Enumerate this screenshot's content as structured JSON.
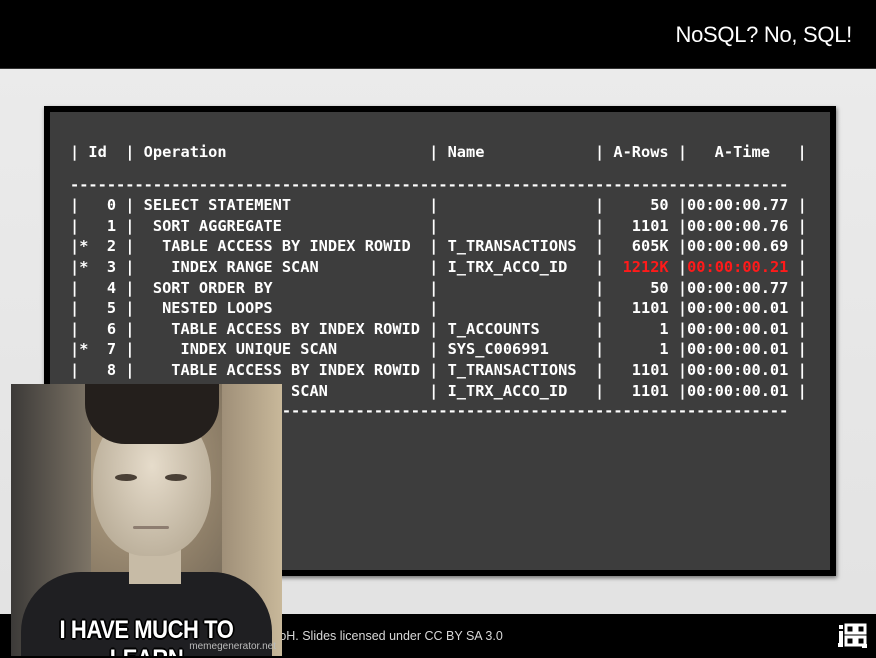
{
  "slide": {
    "title": "NoSQL? No, SQL!"
  },
  "plan": {
    "header": "| Id  | Operation                      | Name            | A-Rows |   A-Time   |",
    "separator": "------------------------------------------------------------------------------",
    "rows": [
      {
        "pre": "|   0 | SELECT STATEMENT               |                 |     50 |",
        "time": "00:00:00.77",
        "post": " |"
      },
      {
        "pre": "|   1 |  SORT AGGREGATE                |                 |   1101 |",
        "time": "00:00:00.76",
        "post": " |"
      },
      {
        "pre": "|*  2 |   TABLE ACCESS BY INDEX ROWID  | T_TRANSACTIONS  |   605K |",
        "time": "00:00:00.69",
        "post": " |"
      },
      {
        "pre": "|*  3 |    INDEX RANGE SCAN            | I_TRX_ACCO_ID   |  ",
        "rows_hl": "1212K",
        "sep": " |",
        "time_hl": "00:00:00.21",
        "post": " |"
      },
      {
        "pre": "|   4 |  SORT ORDER BY                 |                 |     50 |",
        "time": "00:00:00.77",
        "post": " |"
      },
      {
        "pre": "|   5 |   NESTED LOOPS                 |                 |   1101 |",
        "time": "00:00:00.01",
        "post": " |"
      },
      {
        "pre": "|   6 |    TABLE ACCESS BY INDEX ROWID | T_ACCOUNTS      |      1 |",
        "time": "00:00:00.01",
        "post": " |"
      },
      {
        "pre": "|*  7 |     INDEX UNIQUE SCAN          | SYS_C006991     |      1 |",
        "time": "00:00:00.01",
        "post": " |"
      },
      {
        "pre": "|   8 |    TABLE ACCESS BY INDEX ROWID | T_TRANSACTIONS  |   1101 |",
        "time": "00:00:00.01",
        "post": " |"
      },
      {
        "pre": "|*  9 |     INDEX RANGE SCAN           | I_TRX_ACCO_ID   |   1101 |",
        "time": "00:00:00.01",
        "post": " |"
      }
    ],
    "highlight_color": "#ff1a1a"
  },
  "footer": {
    "license": "ɔH. Slides licensed under CC BY SA 3.0",
    "logo_icon": "jooq-logo-icon"
  },
  "meme": {
    "caption": "I HAVE MUCH TO LEARN",
    "watermark": "memegenerator.net"
  }
}
